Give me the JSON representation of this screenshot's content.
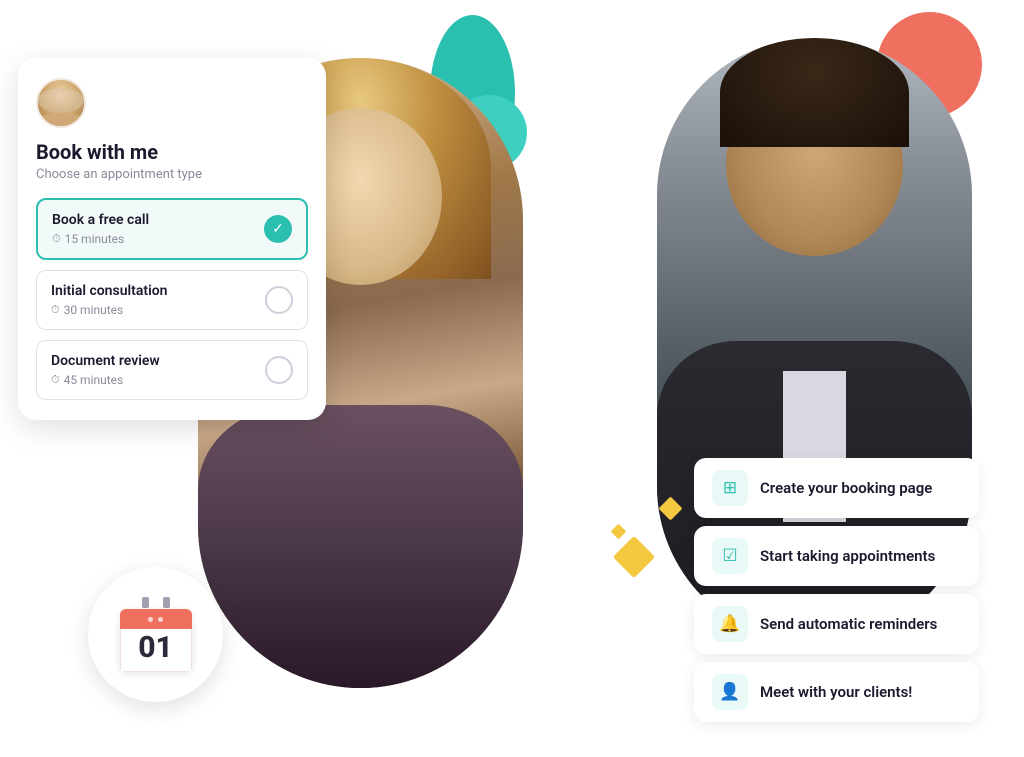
{
  "page": {
    "background": "#ffffff"
  },
  "booking_card": {
    "title": "Book with me",
    "subtitle": "Choose an appointment type",
    "appointments": [
      {
        "id": "free-call",
        "name": "Book a free call",
        "duration": "15 minutes",
        "selected": true
      },
      {
        "id": "initial-consult",
        "name": "Initial consultation",
        "duration": "30 minutes",
        "selected": false
      },
      {
        "id": "doc-review",
        "name": "Document review",
        "duration": "45 minutes",
        "selected": false
      }
    ]
  },
  "calendar": {
    "day": "01"
  },
  "features": [
    {
      "id": "create-booking",
      "icon": "🗓",
      "text": "Create your booking page"
    },
    {
      "id": "start-appointments",
      "icon": "✅",
      "text": "Start taking appointments"
    },
    {
      "id": "send-reminders",
      "icon": "🔔",
      "text": "Send automatic reminders"
    },
    {
      "id": "meet-clients",
      "icon": "👤",
      "text": "Meet with your clients!"
    }
  ],
  "decorative": {
    "teal_color": "#2bbfaf",
    "coral_color": "#f0705a",
    "gold_color": "#f5c842"
  }
}
